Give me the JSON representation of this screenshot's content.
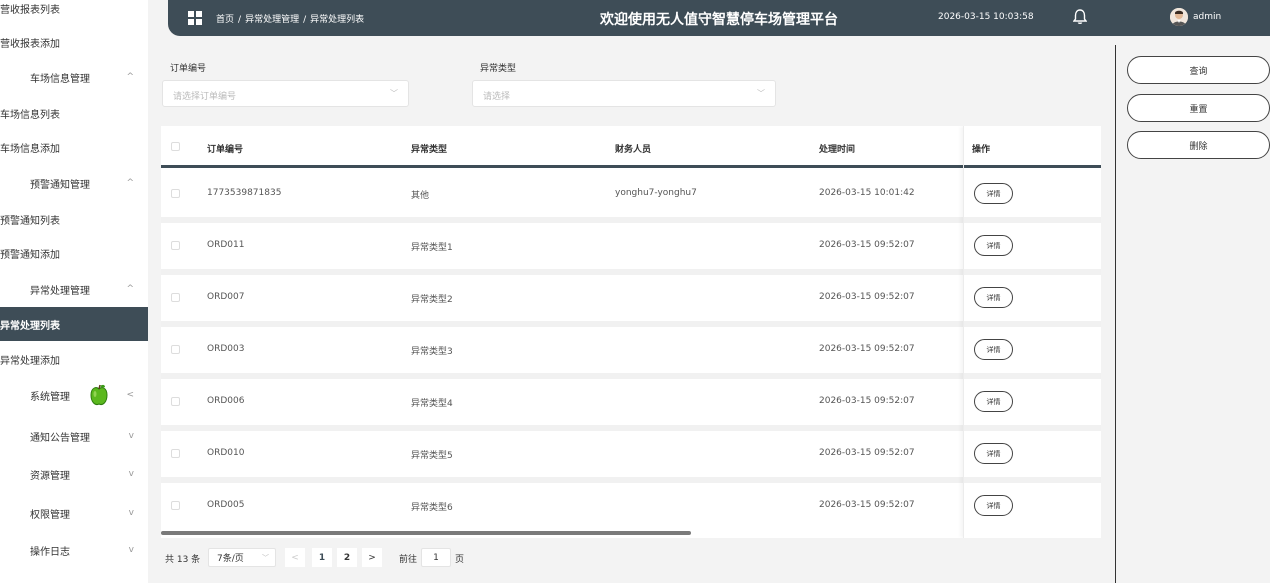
{
  "sidebar": {
    "items": [
      {
        "label": "营收报表列表",
        "type": "leaf"
      },
      {
        "label": "营收报表添加",
        "type": "leaf"
      },
      {
        "label": "车场信息管理",
        "type": "group",
        "arrow": "^"
      },
      {
        "label": "车场信息列表",
        "type": "leaf"
      },
      {
        "label": "车场信息添加",
        "type": "leaf"
      },
      {
        "label": "预警通知管理",
        "type": "group",
        "arrow": "^"
      },
      {
        "label": "预警通知列表",
        "type": "leaf"
      },
      {
        "label": "预警通知添加",
        "type": "leaf"
      },
      {
        "label": "异常处理管理",
        "type": "group",
        "arrow": "^"
      },
      {
        "label": "异常处理列表",
        "type": "leaf",
        "active": true
      },
      {
        "label": "异常处理添加",
        "type": "leaf"
      },
      {
        "label": "系统管理",
        "type": "group",
        "arrow": "<"
      },
      {
        "label": "通知公告管理",
        "type": "group",
        "arrow": "v"
      },
      {
        "label": "资源管理",
        "type": "group",
        "arrow": "v"
      },
      {
        "label": "权限管理",
        "type": "group",
        "arrow": "v"
      },
      {
        "label": "操作日志",
        "type": "group",
        "arrow": "v"
      }
    ]
  },
  "header": {
    "breadcrumb": [
      "首页",
      "异常处理管理",
      "异常处理列表"
    ],
    "separator": "/",
    "title": "欢迎使用无人值守智慧停车场管理平台",
    "datetime": "2026-03-15 10:03:58",
    "username": "admin",
    "bg_color": "#3e4d57"
  },
  "filters": {
    "order_label": "订单编号",
    "order_placeholder": "请选择订单编号",
    "type_label": "异常类型",
    "type_placeholder": "请选择"
  },
  "actions": {
    "query": "查询",
    "reset": "重置",
    "delete": "删除"
  },
  "table": {
    "columns": [
      "订单编号",
      "异常类型",
      "财务人员",
      "处理时间",
      "操作"
    ],
    "detail_label": "详情",
    "rows": [
      {
        "order": "1773539871835",
        "type": "其他",
        "staff": "yonghu7-yonghu7",
        "time": "2026-03-15 10:01:42"
      },
      {
        "order": "ORD011",
        "type": "异常类型1",
        "staff": "",
        "time": "2026-03-15 09:52:07"
      },
      {
        "order": "ORD007",
        "type": "异常类型2",
        "staff": "",
        "time": "2026-03-15 09:52:07"
      },
      {
        "order": "ORD003",
        "type": "异常类型3",
        "staff": "",
        "time": "2026-03-15 09:52:07"
      },
      {
        "order": "ORD006",
        "type": "异常类型4",
        "staff": "",
        "time": "2026-03-15 09:52:07"
      },
      {
        "order": "ORD010",
        "type": "异常类型5",
        "staff": "",
        "time": "2026-03-15 09:52:07"
      },
      {
        "order": "ORD005",
        "type": "异常类型6",
        "staff": "",
        "time": "2026-03-15 09:52:07"
      }
    ]
  },
  "pagination": {
    "total": "共 13 条",
    "page_size": "7条/页",
    "prev": "<",
    "pages": [
      "1",
      "2"
    ],
    "current": "1",
    "next": ">",
    "goto_label": "前往",
    "goto_value": "1",
    "page_suffix": "页"
  }
}
